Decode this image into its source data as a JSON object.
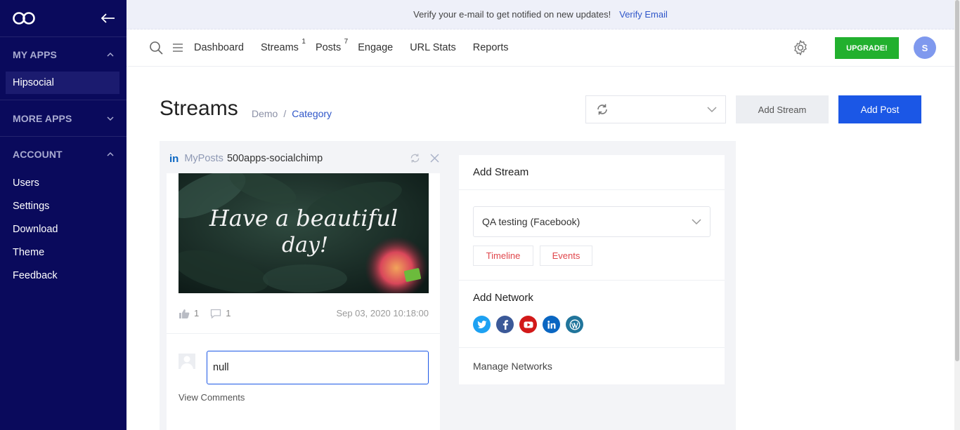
{
  "sidebar": {
    "sections": [
      {
        "title": "MY APPS",
        "items": [
          "Hipsocial"
        ]
      },
      {
        "title": "MORE APPS",
        "items": []
      },
      {
        "title": "ACCOUNT",
        "items": [
          "Users",
          "Settings",
          "Download",
          "Theme",
          "Feedback"
        ]
      }
    ]
  },
  "banner": {
    "text": "Verify your e-mail to get notified on new updates!",
    "link": "Verify Email"
  },
  "nav": {
    "items": [
      {
        "label": "Dashboard",
        "badge": ""
      },
      {
        "label": "Streams",
        "badge": "1"
      },
      {
        "label": "Posts",
        "badge": "7"
      },
      {
        "label": "Engage",
        "badge": ""
      },
      {
        "label": "URL Stats",
        "badge": ""
      },
      {
        "label": "Reports",
        "badge": ""
      }
    ],
    "upgrade_label": "UPGRADE!",
    "avatar_initial": "S"
  },
  "page": {
    "title": "Streams",
    "breadcrumb": [
      "Demo",
      "Category"
    ],
    "add_stream_label": "Add Stream",
    "add_post_label": "Add Post"
  },
  "stream": {
    "network_badge": "in",
    "type": "MyPosts",
    "name": "500apps-socialchimp",
    "post": {
      "image_text_1": "Have a beautiful",
      "image_text_2": "day!",
      "likes": "1",
      "comments": "1",
      "date": "Sep 03, 2020 10:18:00"
    },
    "comment_value": "null",
    "view_comments": "View Comments"
  },
  "add_stream_panel": {
    "title": "Add Stream",
    "account_selected": "QA testing (Facebook)",
    "tags": [
      "Timeline",
      "Events"
    ],
    "add_network_title": "Add Network",
    "manage_label": "Manage Networks"
  },
  "colors": {
    "sidebar_bg": "#0a0a5c",
    "primary": "#1b57e6",
    "upgrade": "#22b02e",
    "twitter": "#1da1f2",
    "facebook": "#3b5998",
    "youtube": "#d21919",
    "linkedin": "#0a66c2",
    "wordpress": "#21759b"
  }
}
